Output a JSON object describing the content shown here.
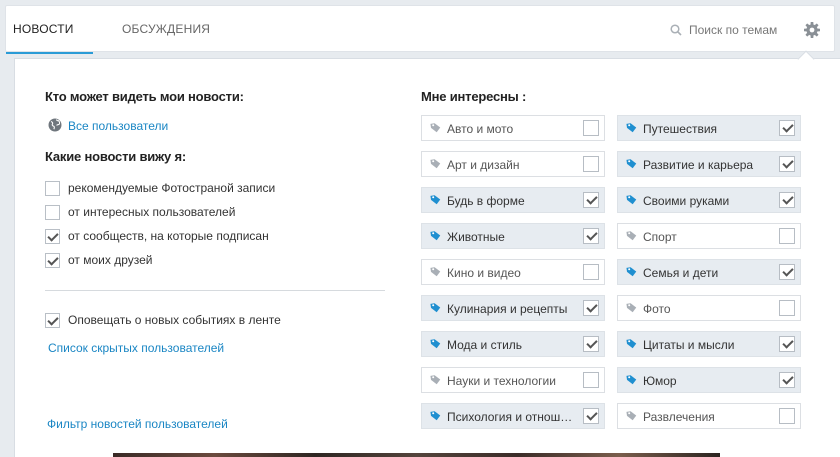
{
  "tabs": {
    "news": "НОВОСТИ",
    "discussions": "ОБСУЖДЕНИЯ"
  },
  "search": {
    "placeholder": "Поиск по темам"
  },
  "left": {
    "who_sees_heading": "Кто может видеть мои новости:",
    "who_sees_value": "Все пользователи",
    "what_see_heading": "Какие новости вижу я:",
    "options": [
      {
        "label": "рекомендуемые Фотостраной записи",
        "checked": false
      },
      {
        "label": "от интересных пользователей",
        "checked": false
      },
      {
        "label": "от сообществ, на которые подписан",
        "checked": true
      },
      {
        "label": "от моих друзей",
        "checked": true
      }
    ],
    "notify": {
      "label": "Оповещать о новых событиях в ленте",
      "checked": true
    },
    "hidden_users_link": "Список скрытых пользователей",
    "filter_link": "Фильтр новостей пользователей"
  },
  "interests": {
    "heading": "Мне интересны :",
    "items": [
      {
        "label": "Авто и мото",
        "checked": false
      },
      {
        "label": "Путешествия",
        "checked": true
      },
      {
        "label": "Арт и дизайн",
        "checked": false
      },
      {
        "label": "Развитие и карьера",
        "checked": true
      },
      {
        "label": "Будь в форме",
        "checked": true
      },
      {
        "label": "Своими руками",
        "checked": true
      },
      {
        "label": "Животные",
        "checked": true
      },
      {
        "label": "Спорт",
        "checked": false
      },
      {
        "label": "Кино и видео",
        "checked": false
      },
      {
        "label": "Семья и дети",
        "checked": true
      },
      {
        "label": "Кулинария и рецепты",
        "checked": true
      },
      {
        "label": "Фото",
        "checked": false
      },
      {
        "label": "Мода и стиль",
        "checked": true
      },
      {
        "label": "Цитаты и мысли",
        "checked": true
      },
      {
        "label": "Науки и технологии",
        "checked": false
      },
      {
        "label": "Юмор",
        "checked": true
      },
      {
        "label": "Психология и отнош…",
        "checked": true
      },
      {
        "label": "Развлечения",
        "checked": false
      }
    ]
  },
  "colors": {
    "accent": "#2a9bd6",
    "link": "#1a86c4",
    "tag_on": "#1f8fd0",
    "tag_off": "#a9afb6"
  }
}
